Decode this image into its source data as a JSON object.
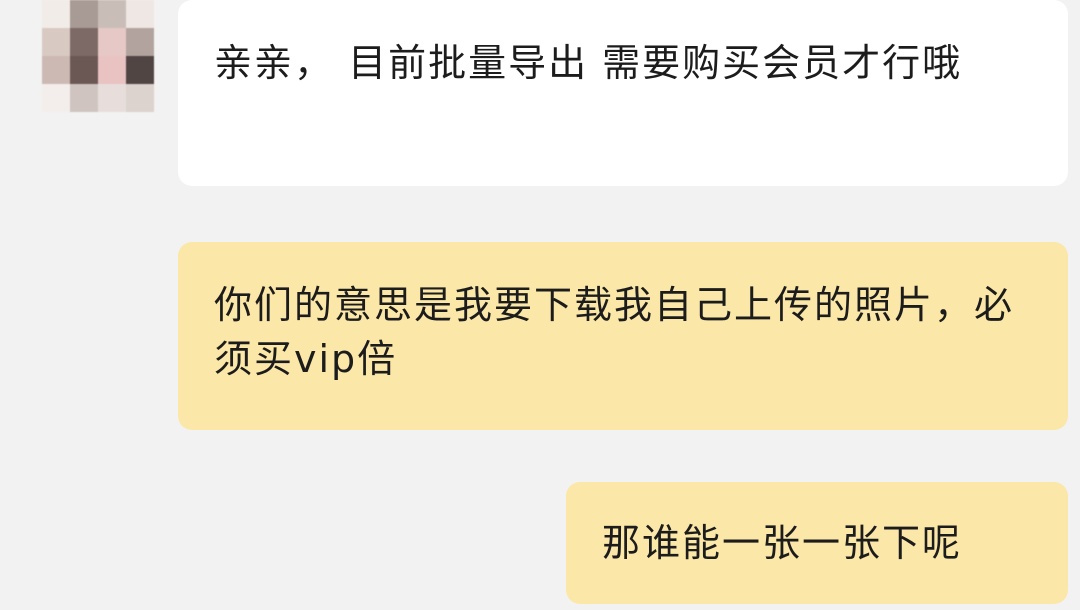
{
  "chat": {
    "messages": [
      {
        "sender": "other",
        "text": "亲亲， 目前批量导出 需要购买会员才行哦"
      },
      {
        "sender": "self",
        "text": "你们的意思是我要下载我自己上传的照片，必须买vip倍"
      },
      {
        "sender": "self",
        "text": "那谁能一张一张下呢"
      }
    ]
  },
  "colors": {
    "background": "#f2f2f2",
    "incoming_bubble": "#ffffff",
    "outgoing_bubble": "#fbe7a8",
    "text": "#1c1c1c"
  }
}
